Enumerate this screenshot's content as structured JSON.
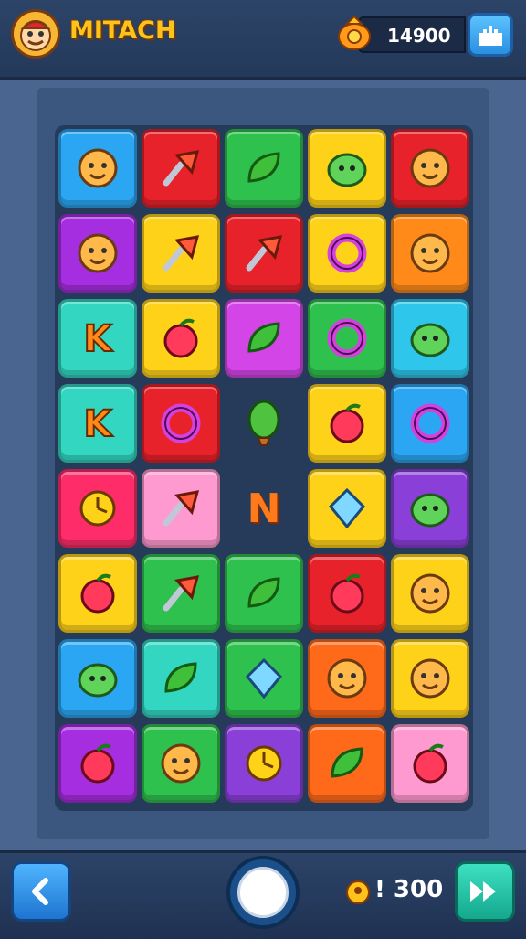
{
  "header": {
    "title": "MITACH",
    "score": "14900",
    "avatar_icon": "face-avatar-icon",
    "coin_icon": "coin-bag-icon",
    "menu_icon": "castle-menu-icon"
  },
  "board": {
    "rows": 8,
    "cols": 5,
    "empty_letter": "N",
    "tiles": [
      [
        "#2aa6f2",
        "bear-face-icon"
      ],
      [
        "#e8222a",
        "lollipop-icon"
      ],
      [
        "#2fc14d",
        "leaf-icon"
      ],
      [
        "#ffd21a",
        "blue-blob-icon"
      ],
      [
        "#e8222a",
        "cookie-face-icon"
      ],
      [
        "#a52ee0",
        "bear-face-icon"
      ],
      [
        "#ffd21a",
        "pin-icon"
      ],
      [
        "#e8222a",
        "screw-icon"
      ],
      [
        "#ffd21a",
        "ring-icon"
      ],
      [
        "#ff8a1a",
        "snail-icon"
      ],
      [
        "#33d6c0",
        "letter-g-icon"
      ],
      [
        "#ffd21a",
        "radish-icon"
      ],
      [
        "#d445e8",
        "flower-icon"
      ],
      [
        "#2fc14d",
        "donut-icon"
      ],
      [
        "#2ec6ea",
        "green-blob-icon"
      ],
      [
        "#33d6c0",
        "letter-k-icon"
      ],
      [
        "#e8222a",
        "hex-nut-icon"
      ],
      [
        "",
        "balloon-icon"
      ],
      [
        "#ffd21a",
        "heart-bloom-icon"
      ],
      [
        "#2aa6f2",
        "pretzel-icon"
      ],
      [
        "#ff2c6a",
        "clock-icon"
      ],
      [
        "#ff9ad0",
        "fish-icon"
      ],
      [
        "",
        "letter-n-icon"
      ],
      [
        "#ffd21a",
        "crystal-icon"
      ],
      [
        "#8a3fd8",
        "turtle-icon"
      ],
      [
        "#ffd21a",
        "melon-icon"
      ],
      [
        "#2fc14d",
        "pin-icon"
      ],
      [
        "#2fc14d",
        "lemon-icon"
      ],
      [
        "#e8222a",
        "heart-key-icon"
      ],
      [
        "#ffd21a",
        "sunglasses-face-icon"
      ],
      [
        "#2aa6f2",
        "pink-blob-icon"
      ],
      [
        "#33d6c0",
        "banana-icon"
      ],
      [
        "#2fc14d",
        "candy-icon"
      ],
      [
        "#ff6a1a",
        "green-face-icon"
      ],
      [
        "#ffd21a",
        "purple-face-icon"
      ],
      [
        "#a52ee0",
        "apple-icon"
      ],
      [
        "#2fc14d",
        "robot-face-icon"
      ],
      [
        "#8a3fd8",
        "orange-ball-icon"
      ],
      [
        "#ff6a1a",
        "green-leaf-icon"
      ],
      [
        "#ff9ad0",
        "berry-icon"
      ]
    ]
  },
  "footer": {
    "back_icon": "chevron-left-icon",
    "center_icon": "circle-button-icon",
    "count": "! 300",
    "coin_icon": "coin-icon",
    "forward_icon": "fast-forward-icon"
  },
  "colors": {
    "background": "#4a6690",
    "board": "#263a5a",
    "title": "#ffc21a",
    "accent_blue": "#2a8fe0",
    "accent_teal": "#14a88e"
  }
}
